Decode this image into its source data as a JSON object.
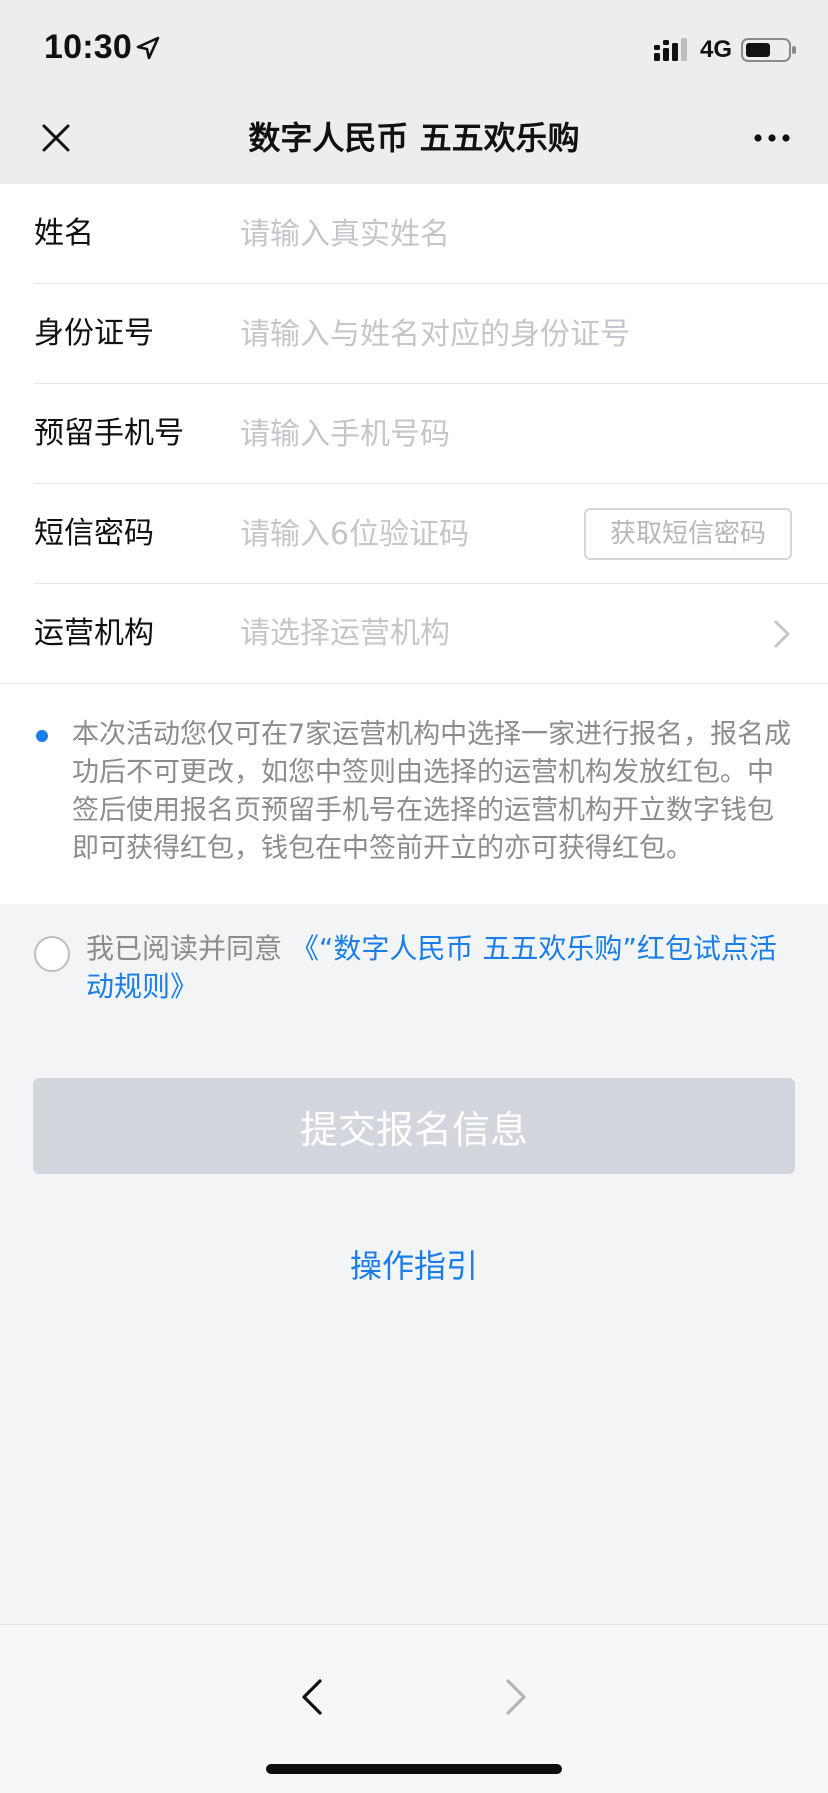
{
  "status_bar": {
    "time": "10:30",
    "network": "4G",
    "icons": [
      "location-arrow-icon",
      "signal-icon",
      "battery-icon"
    ]
  },
  "header": {
    "title": "数字人民币 五五欢乐购",
    "left_icon": "close-icon",
    "right_icon": "more-icon"
  },
  "form": {
    "name": {
      "label": "姓名",
      "placeholder": "请输入真实姓名",
      "value": ""
    },
    "id_number": {
      "label": "身份证号",
      "placeholder": "请输入与姓名对应的身份证号",
      "value": ""
    },
    "phone": {
      "label": "预留手机号",
      "placeholder": "请输入手机号码",
      "value": ""
    },
    "sms_code": {
      "label": "短信密码",
      "placeholder": "请输入6位验证码",
      "value": "",
      "button_label": "获取短信密码"
    },
    "operator": {
      "label": "运营机构",
      "placeholder": "请选择运营机构"
    }
  },
  "notice": {
    "text": "本次活动您仅可在7家运营机构中选择一家进行报名，报名成功后不可更改，如您中签则由选择的运营机构发放红包。中签后使用报名页预留手机号在选择的运营机构开立数字钱包即可获得红包，钱包在中签前开立的亦可获得红包。"
  },
  "agreement": {
    "prefix": "我已阅读并同意 ",
    "link": "《“数字人民币 五五欢乐购”红包试点活动规则》",
    "checked": false
  },
  "actions": {
    "submit_label": "提交报名信息",
    "guide_label": "操作指引"
  },
  "bottom_nav": {
    "back_icon": "chevron-left-icon",
    "forward_icon": "chevron-right-icon"
  },
  "colors": {
    "accent": "#1a7ee8",
    "submit_disabled": "#d3d6dc",
    "placeholder": "#c4c6cc",
    "header_bg": "#ededed",
    "page_bg": "#f3f4f6"
  }
}
